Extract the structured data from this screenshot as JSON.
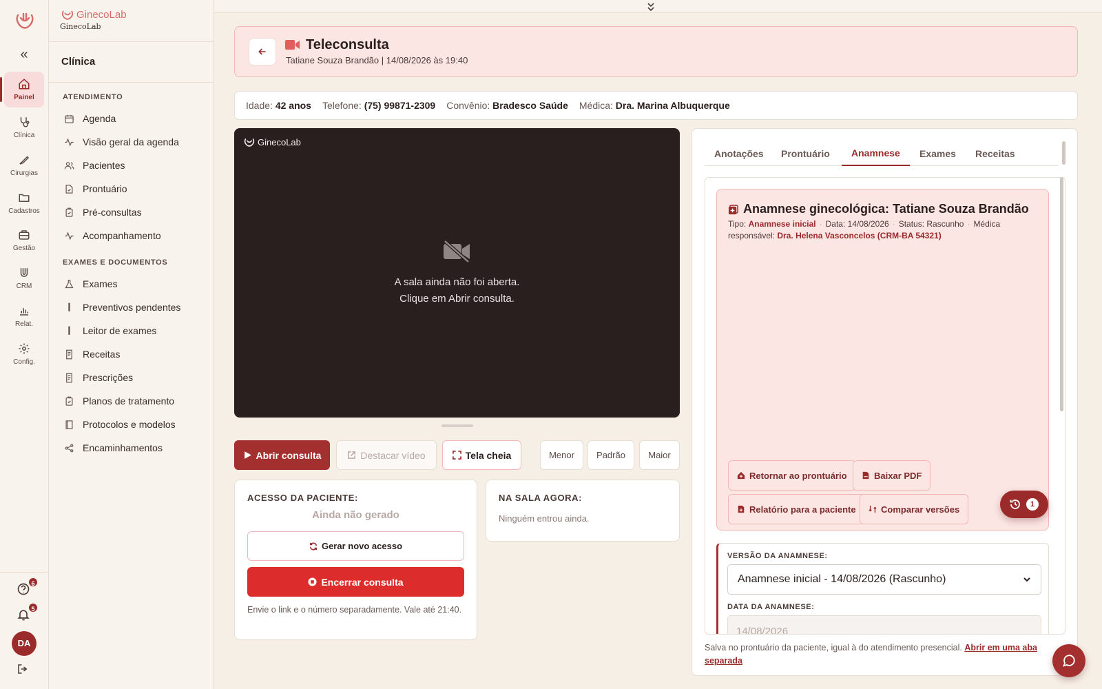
{
  "brand": {
    "name": "GinecoLab",
    "sub": "GinecoLab"
  },
  "rail": {
    "items": [
      {
        "label": "Painel",
        "icon": "home-icon",
        "active": true
      },
      {
        "label": "Clínica",
        "icon": "stethoscope-icon"
      },
      {
        "label": "Cirurgias",
        "icon": "scalpel-icon"
      },
      {
        "label": "Cadastros",
        "icon": "folder-icon"
      },
      {
        "label": "Gestão",
        "icon": "briefcase-icon"
      },
      {
        "label": "CRM",
        "icon": "magnet-icon"
      },
      {
        "label": "Relat.",
        "icon": "bar-chart-icon"
      },
      {
        "label": "Config.",
        "icon": "gear-icon"
      }
    ],
    "help_badge": "6",
    "notif_badge": "5",
    "avatar": "DA"
  },
  "sidebar": {
    "title": "Clínica",
    "section1": "ATENDIMENTO",
    "section2": "EXAMES E DOCUMENTOS",
    "items1": [
      {
        "label": "Agenda",
        "icon": "calendar-icon"
      },
      {
        "label": "Visão geral da agenda",
        "icon": "activity-icon"
      },
      {
        "label": "Pacientes",
        "icon": "users-icon"
      },
      {
        "label": "Prontuário",
        "icon": "file-medical-icon"
      },
      {
        "label": "Pré-consultas",
        "icon": "clipboard-check-icon"
      },
      {
        "label": "Acompanhamento",
        "icon": "activity-icon"
      }
    ],
    "items2": [
      {
        "label": "Exames",
        "icon": "flask-icon"
      },
      {
        "label": "Preventivos pendentes",
        "icon": "test-tube-icon"
      },
      {
        "label": "Leitor de exames",
        "icon": "test-tube-icon"
      },
      {
        "label": "Receitas",
        "icon": "receipt-icon"
      },
      {
        "label": "Prescrições",
        "icon": "receipt-icon"
      },
      {
        "label": "Planos de tratamento",
        "icon": "clipboard-check-icon"
      },
      {
        "label": "Protocolos e modelos",
        "icon": "book-icon"
      },
      {
        "label": "Encaminhamentos",
        "icon": "share-icon"
      }
    ]
  },
  "header": {
    "title": "Teleconsulta",
    "subtitle": "Tatiane Souza Brandão | 14/08/2026 às 19:40"
  },
  "info": {
    "age_label": "Idade:",
    "age": "42 anos",
    "phone_label": "Telefone:",
    "phone": "(75) 99871-2309",
    "insurance_label": "Convênio:",
    "insurance": "Bradesco Saúde",
    "doctor_label": "Médica:",
    "doctor": "Dra. Marina Albuquerque"
  },
  "video": {
    "logo": "GinecoLab",
    "message_line1": "A sala ainda não foi aberta.",
    "message_line2": "Clique em Abrir consulta."
  },
  "controls": {
    "open": "Abrir consulta",
    "detach": "Destacar vídeo",
    "fullscreen": "Tela cheia",
    "smaller": "Menor",
    "default": "Padrão",
    "larger": "Maior"
  },
  "access": {
    "label": "ACESSO DA PACIENTE:",
    "status": "Ainda não gerado",
    "generate": "Gerar novo acesso",
    "end": "Encerrar consulta",
    "note": "Envie o link e o número separadamente. Vale até 21:40."
  },
  "room": {
    "label": "NA SALA AGORA:",
    "empty": "Ninguém entrou ainda."
  },
  "tabs": [
    "Anotações",
    "Prontuário",
    "Anamnese",
    "Exames",
    "Receitas"
  ],
  "active_tab": "Anamnese",
  "anamnese": {
    "title": "Anamnese ginecológica: Tatiane Souza Brandão",
    "type_label": "Tipo:",
    "type": "Anamnese inicial",
    "date": "Data: 14/08/2026",
    "status": "Status: Rascunho",
    "doctor_label": "Médica responsável:",
    "doctor": "Dra. Helena Vasconcelos (CRM-BA 54321)",
    "actions": {
      "back": "Retornar ao prontuário",
      "pdf": "Baixar PDF",
      "report": "Relatório para a paciente",
      "compare": "Comparar versões"
    },
    "history_count": "1"
  },
  "version": {
    "label": "VERSÃO DA ANAMNESE:",
    "selected": "Anamnese inicial - 14/08/2026 (Rascunho)",
    "date_label": "DATA DA ANAMNESE:",
    "date_value": "14/08/2026"
  },
  "footer": {
    "note": "Salva no prontuário da paciente, igual à do atendimento presencial.",
    "link": "Abrir em uma aba separada"
  },
  "colors": {
    "primary": "#9b2b2b",
    "danger": "#dd2c2c",
    "accent_bg": "#fce6e4",
    "page_bg": "#f6efe6"
  }
}
